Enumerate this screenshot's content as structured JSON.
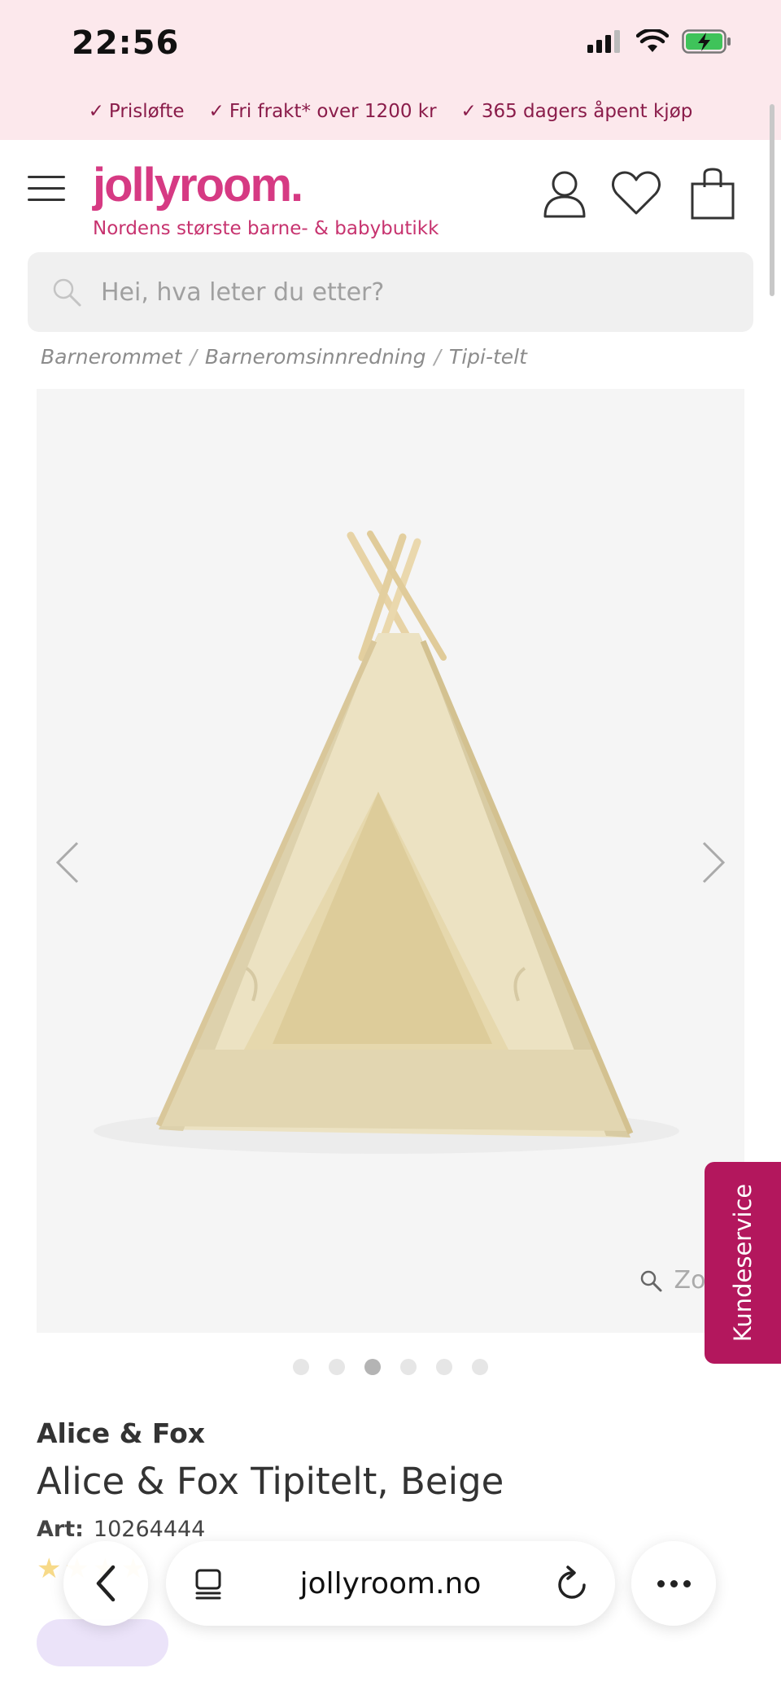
{
  "status_bar": {
    "time": "22:56"
  },
  "usp": [
    {
      "label": "Prisløfte"
    },
    {
      "label": "Fri frakt* over 1200 kr"
    },
    {
      "label": "365 dagers åpent kjøp"
    }
  ],
  "header": {
    "logo": "jollyroom.",
    "tagline": "Nordens største barne- & babybutikk"
  },
  "search": {
    "placeholder": "Hei, hva leter du etter?"
  },
  "breadcrumb": [
    "Barnerommet",
    "Barneromsinnredning",
    "Tipi-telt"
  ],
  "gallery": {
    "zoom_label": "Zoom",
    "slide_count": 6,
    "active_slide": 3
  },
  "kundeservice": {
    "label": "Kundeservice"
  },
  "product": {
    "brand": "Alice & Fox",
    "title": "Alice & Fox Tipitelt, Beige",
    "art_label": "Art:",
    "art_number": "10264444"
  },
  "browser": {
    "url": "jollyroom.no"
  },
  "colors": {
    "brand_pink": "#d63a83",
    "topbar_bg": "#fce8ec",
    "kundeservice_bg": "#b3175d"
  }
}
